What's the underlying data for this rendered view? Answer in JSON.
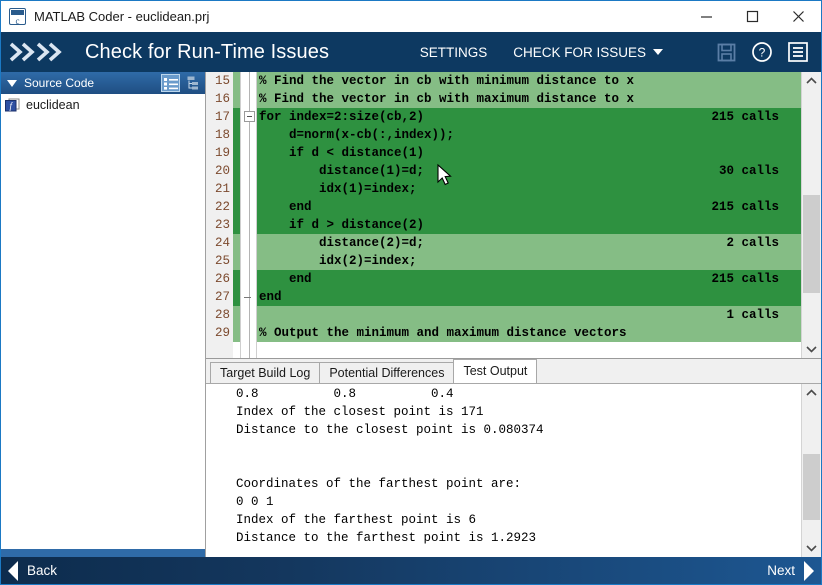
{
  "window": {
    "title": "MATLAB Coder - euclidean.prj",
    "app_icon": "matlab-coder-icon",
    "minimize_label": "—",
    "maximize_label": "□",
    "close_label": "✕"
  },
  "banner": {
    "logo_icon": "double-chevron-logo",
    "title": "Check for Run-Time Issues",
    "settings_label": "SETTINGS",
    "check_label": "CHECK FOR ISSUES",
    "check_has_caret": true,
    "icons": [
      {
        "name": "save-icon",
        "label": "Save",
        "enabled": false
      },
      {
        "name": "help-icon",
        "label": "Help",
        "enabled": true
      },
      {
        "name": "menu-icon",
        "label": "Menu",
        "enabled": true
      }
    ],
    "background_color": "#0d3961"
  },
  "sidebar": {
    "header_title": "Source Code",
    "collapse_icon": "triangle-down-icon",
    "view_icons": [
      {
        "name": "list-view-icon",
        "selected": true
      },
      {
        "name": "tree-view-icon",
        "selected": false
      }
    ],
    "items": [
      {
        "label": "euclidean",
        "icon": "function-icon"
      }
    ]
  },
  "code": {
    "lines": [
      {
        "num": "15",
        "text": "% Find the vector in cb with minimum distance to x",
        "calls": "",
        "coverage": "light"
      },
      {
        "num": "16",
        "text": "% Find the vector in cb with maximum distance to x",
        "calls": "",
        "coverage": "light"
      },
      {
        "num": "17",
        "text": "for index=2:size(cb,2)",
        "calls": "215 calls",
        "coverage": "dark"
      },
      {
        "num": "18",
        "text": "    d=norm(x-cb(:,index));",
        "calls": "",
        "coverage": "dark"
      },
      {
        "num": "19",
        "text": "    if d < distance(1)",
        "calls": "",
        "coverage": "dark"
      },
      {
        "num": "20",
        "text": "        distance(1)=d;",
        "calls": "30 calls",
        "coverage": "dark"
      },
      {
        "num": "21",
        "text": "        idx(1)=index;",
        "calls": "",
        "coverage": "dark"
      },
      {
        "num": "22",
        "text": "    end",
        "calls": "215 calls",
        "coverage": "dark"
      },
      {
        "num": "23",
        "text": "    if d > distance(2)",
        "calls": "",
        "coverage": "dark"
      },
      {
        "num": "24",
        "text": "        distance(2)=d;",
        "calls": "2 calls",
        "coverage": "light"
      },
      {
        "num": "25",
        "text": "        idx(2)=index;",
        "calls": "",
        "coverage": "light"
      },
      {
        "num": "26",
        "text": "    end",
        "calls": "215 calls",
        "coverage": "dark"
      },
      {
        "num": "27",
        "text": "end",
        "calls": "",
        "coverage": "dark"
      },
      {
        "num": "28",
        "text": "",
        "calls": "1 calls",
        "coverage": "light"
      },
      {
        "num": "29",
        "text": "% Output the minimum and maximum distance vectors",
        "calls": "",
        "coverage": "light"
      }
    ],
    "coverage_colors": {
      "dark": "#2e9140",
      "light": "#85bd85"
    },
    "fold_markers": [
      {
        "line_index": 2,
        "type": "collapse-box"
      },
      {
        "line_index": 12,
        "type": "end-tick"
      }
    ],
    "scrollbar": {
      "up_icon": "chevron-up-icon",
      "down_icon": "chevron-down-icon"
    }
  },
  "output": {
    "tabs": [
      {
        "label": "Target Build Log",
        "active": false
      },
      {
        "label": "Potential Differences",
        "active": false
      },
      {
        "label": "Test Output",
        "active": true
      }
    ],
    "lines": [
      "0.8          0.8          0.4",
      "Index of the closest point is 171",
      "Distance to the closest point is 0.080374",
      "",
      "",
      "Coordinates of the farthest point are:",
      "0 0 1",
      "Index of the farthest point is 6",
      "Distance to the farthest point is 1.2923"
    ],
    "scrollbar": {
      "up_icon": "chevron-up-icon",
      "down_icon": "chevron-down-icon"
    }
  },
  "footer": {
    "back_label": "Back",
    "back_icon": "chevron-left-icon",
    "next_label": "Next",
    "next_icon": "chevron-right-icon"
  }
}
